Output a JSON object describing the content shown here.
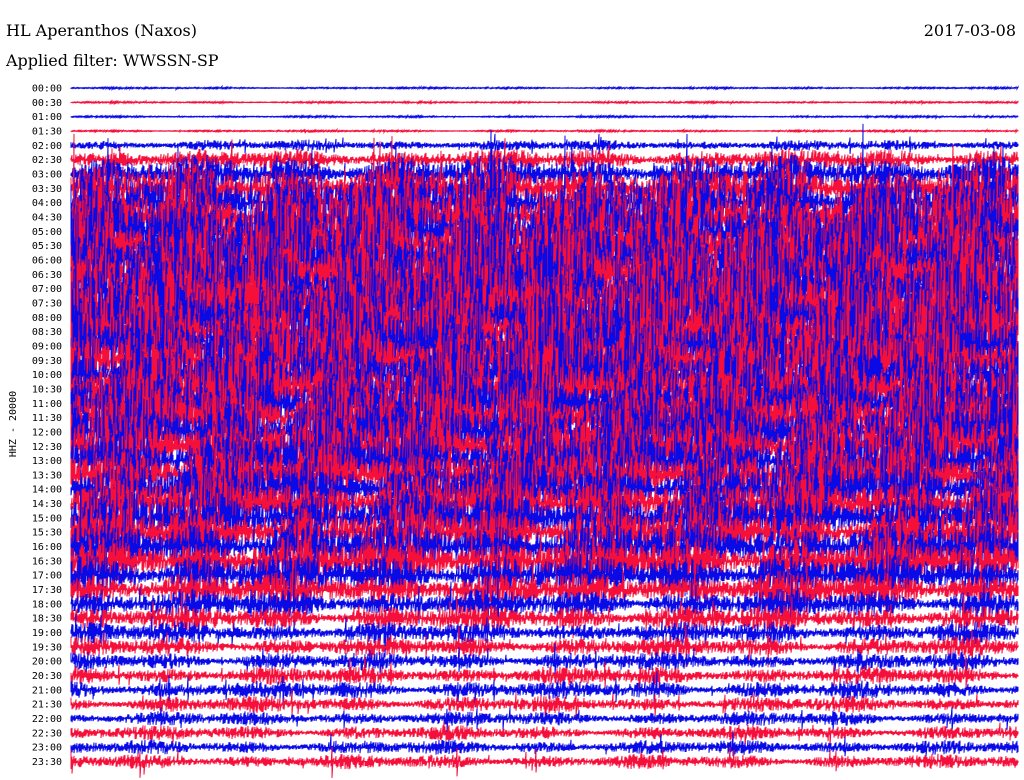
{
  "header": {
    "station": "HL Aperanthos (Naxos)",
    "filter": "Applied filter: WWSSN-SP",
    "date": "2017-03-08"
  },
  "channel_label": "HHZ - 20000",
  "colors": {
    "trace_a": "#0a0ae6",
    "trace_b": "#f5103c",
    "background": "#ffffff",
    "text": "#000000"
  },
  "chart_data": {
    "type": "line",
    "title": "HL Aperanthos (Naxos)",
    "subtitle": "Applied filter: WWSSN-SP",
    "date": "2017-03-08",
    "ylabel": "HHZ - 20000",
    "xlabel": "",
    "grid": false,
    "legend": "none",
    "row_interval_minutes": 30,
    "row_labels": [
      "00:00",
      "00:30",
      "01:00",
      "01:30",
      "02:00",
      "02:30",
      "03:00",
      "03:30",
      "04:00",
      "04:30",
      "05:00",
      "05:30",
      "06:00",
      "06:30",
      "07:00",
      "07:30",
      "08:00",
      "08:30",
      "09:00",
      "09:30",
      "10:00",
      "10:30",
      "11:00",
      "11:30",
      "12:00",
      "12:30",
      "13:00",
      "13:30",
      "14:00",
      "14:30",
      "15:00",
      "15:30",
      "16:00",
      "16:30",
      "17:00",
      "17:30",
      "18:00",
      "18:30",
      "19:00",
      "19:30",
      "20:00",
      "20:30",
      "21:00",
      "21:30",
      "22:00",
      "22:30",
      "23:00",
      "23:30"
    ],
    "row_colors": [
      "trace_a",
      "trace_b"
    ],
    "relative_amplitude": [
      0.05,
      0.05,
      0.05,
      0.05,
      0.3,
      0.6,
      1.0,
      1.4,
      1.9,
      2.3,
      2.6,
      2.8,
      3.0,
      3.0,
      3.0,
      3.0,
      3.0,
      3.0,
      2.9,
      2.8,
      2.7,
      2.6,
      2.5,
      2.4,
      2.3,
      2.2,
      2.1,
      2.0,
      1.9,
      1.8,
      1.7,
      1.6,
      1.5,
      1.4,
      1.2,
      1.0,
      0.8,
      0.7,
      0.6,
      0.55,
      0.5,
      0.5,
      0.5,
      0.45,
      0.4,
      0.4,
      0.4,
      0.4
    ]
  }
}
